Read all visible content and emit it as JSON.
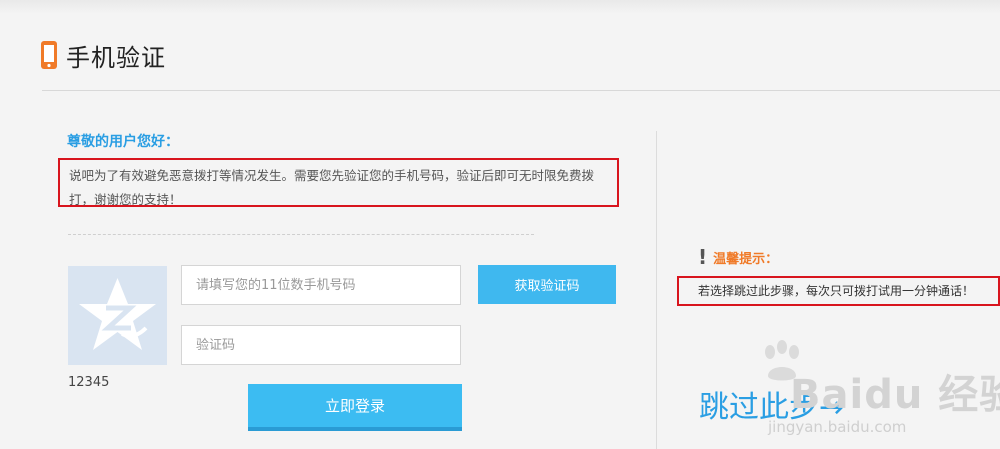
{
  "header": {
    "title": "手机验证",
    "icon": "phone-icon"
  },
  "greeting": "尊敬的用户您好：",
  "notice": {
    "line1": "说吧为了有效避免恶意拨打等情况发生。需要您先验证您的手机号码，验证后即可无时限免费拨",
    "line2": "打，谢谢您的支持！"
  },
  "avatar": {
    "icon": "qq-star-icon",
    "id_text": "12345"
  },
  "form": {
    "phone_placeholder": "请填写您的11位数手机号码",
    "code_placeholder": "验证码",
    "get_code_label": "获取验证码",
    "login_label": "立即登录"
  },
  "tip": {
    "title": "温馨提示：",
    "text": "若选择跳过此步骤，每次只可拨打试用一分钟通话！"
  },
  "skip": {
    "label": "跳过此步→"
  },
  "watermark": {
    "brand": "Baidu 经验",
    "url": "jingyan.baidu.com"
  },
  "colors": {
    "accent_blue": "#2a9ee3",
    "button_blue": "#3fb8ef",
    "highlight_red": "#d8141d",
    "tip_orange": "#f07a28",
    "icon_orange": "#f07a28"
  }
}
